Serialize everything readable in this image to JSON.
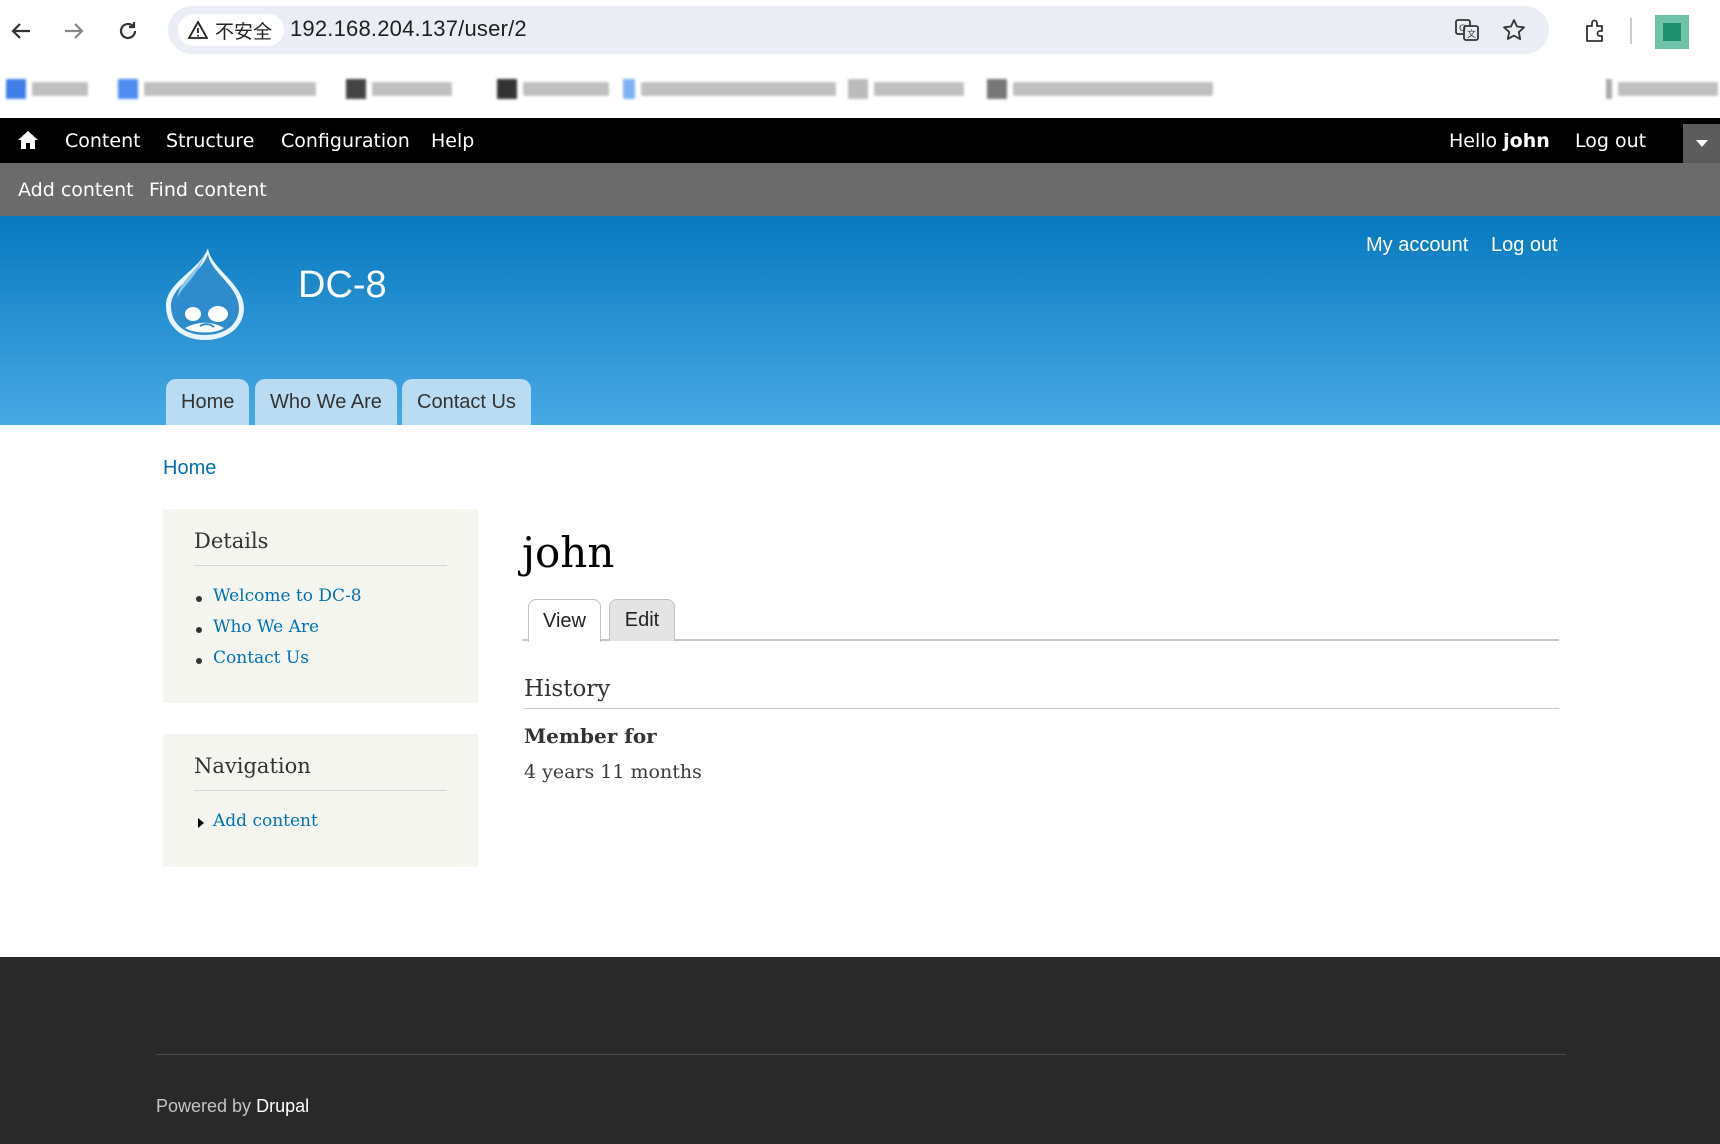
{
  "browser": {
    "security_label": "不安全",
    "url": "192.168.204.137/user/2"
  },
  "toolbar": {
    "items": [
      "Content",
      "Structure",
      "Configuration",
      "Help"
    ],
    "hello": "Hello",
    "username": "john",
    "logout": "Log out"
  },
  "tray": {
    "items": [
      "Add content",
      "Find content"
    ]
  },
  "header": {
    "site_name": "DC-8",
    "secondary_menu": [
      "My account",
      "Log out"
    ],
    "main_menu": [
      "Home",
      "Who We Are",
      "Contact Us"
    ]
  },
  "breadcrumb": "Home",
  "sidebar": {
    "details": {
      "title": "Details",
      "links": [
        "Welcome to DC-8",
        "Who We Are",
        "Contact Us"
      ]
    },
    "navigation": {
      "title": "Navigation",
      "links": [
        "Add content"
      ]
    }
  },
  "main": {
    "title": "john",
    "tabs": [
      "View",
      "Edit"
    ],
    "history_heading": "History",
    "member_for_label": "Member for",
    "member_for_value": "4 years 11 months"
  },
  "footer": {
    "powered_by": "Powered by",
    "drupal": "Drupal"
  },
  "colors": {
    "link": "#0071b3",
    "toolbar": "#000000",
    "tray": "#6b6b6b",
    "header_top": "#0779bf",
    "header_bottom": "#48a9e4",
    "footer": "#292929"
  }
}
